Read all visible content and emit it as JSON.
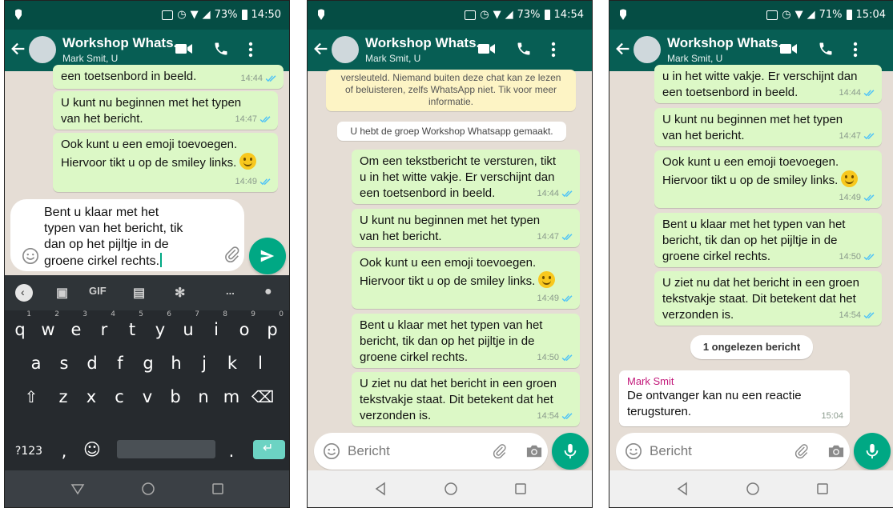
{
  "header": {
    "title": "Workshop Whats...",
    "subtitle": "Mark Smit, U"
  },
  "phones": [
    {
      "status": {
        "battery": "73%",
        "time": "14:50"
      },
      "messages": [
        {
          "text": "een toetsenbord in beeld.",
          "time": "14:44"
        },
        {
          "text": "U kunt nu beginnen met het typen\nvan het bericht.",
          "time": "14:47"
        },
        {
          "text": "Ook kunt u een emoji toevoegen.\nHiervoor tikt u op de smiley links.",
          "time": "14:49"
        }
      ],
      "compose_text": "Bent u klaar met het\ntypen van het bericht, tik\ndan op het pijltje in de\ngroene cirkel rechts.",
      "keyboard": {
        "suggestions": [
          "GIF",
          "..."
        ],
        "row1": [
          "q",
          "w",
          "e",
          "r",
          "t",
          "y",
          "u",
          "i",
          "o",
          "p"
        ],
        "row1_nums": [
          "1",
          "2",
          "3",
          "4",
          "5",
          "6",
          "7",
          "8",
          "9",
          "0"
        ],
        "row2": [
          "a",
          "s",
          "d",
          "f",
          "g",
          "h",
          "j",
          "k",
          "l"
        ],
        "row3": [
          "z",
          "x",
          "c",
          "v",
          "b",
          "n",
          "m"
        ],
        "row4_left": "?123",
        "row4_comma": ",",
        "row4_period": "."
      }
    },
    {
      "status": {
        "battery": "73%",
        "time": "14:54"
      },
      "encryption_notice": "versleuteld. Niemand buiten deze chat kan ze lezen\nof beluisteren, zelfs WhatsApp niet. Tik voor meer\ninformatie.",
      "system_message": "U hebt de groep Workshop Whatsapp gemaakt.",
      "messages": [
        {
          "text": "Om een tekstbericht te versturen, tikt\nu in het witte vakje. Er verschijnt dan\neen toetsenbord in beeld.",
          "time": "14:44"
        },
        {
          "text": "U kunt nu beginnen met het typen\nvan het bericht.",
          "time": "14:47"
        },
        {
          "text": "Ook kunt u een emoji toevoegen.\nHiervoor tikt u op de smiley links.",
          "time": "14:49"
        },
        {
          "text": "Bent u klaar met het typen van het\nbericht, tik dan op het pijltje in de\ngroene cirkel rechts.",
          "time": "14:50"
        },
        {
          "text": "U ziet nu dat het bericht in een groen\ntekstvakje staat. Dit betekent dat het\nverzonden is.",
          "time": "14:54"
        }
      ],
      "input_placeholder": "Bericht"
    },
    {
      "status": {
        "battery": "71%",
        "time": "15:04"
      },
      "messages": [
        {
          "text": "u in het witte vakje. Er verschijnt dan\neen toetsenbord in beeld.",
          "time": "14:44"
        },
        {
          "text": "U kunt nu beginnen met het typen\nvan het bericht.",
          "time": "14:47"
        },
        {
          "text": "Ook kunt u een emoji toevoegen.\nHiervoor tikt u op de smiley links.",
          "time": "14:49"
        },
        {
          "text": "Bent u klaar met het typen van het\nbericht, tik dan op het pijltje in de\ngroene cirkel rechts.",
          "time": "14:50"
        },
        {
          "text": "U ziet nu dat het bericht in een groen\ntekstvakje staat. Dit betekent dat het\nverzonden is.",
          "time": "14:54"
        }
      ],
      "unread_label": "1 ongelezen bericht",
      "incoming": {
        "sender": "Mark Smit",
        "text": "De ontvanger kan nu een reactie\nterugsturen.",
        "time": "15:04"
      },
      "input_placeholder": "Bericht"
    }
  ],
  "colors": {
    "header": "#075e54",
    "statusbar": "#054d44",
    "outgoing": "#dcf8c6",
    "accent": "#00a884",
    "ticks": "#4fc3f7"
  }
}
